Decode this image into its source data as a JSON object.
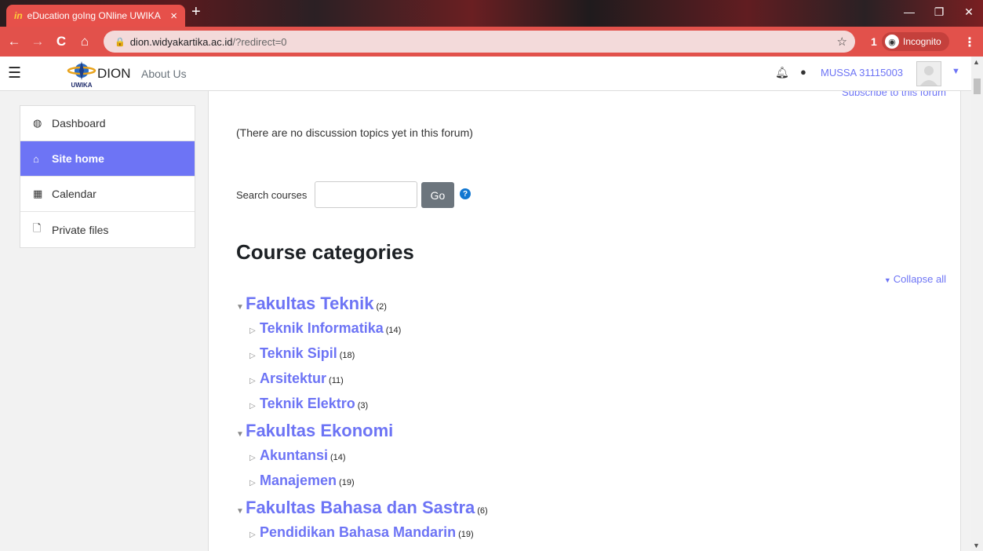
{
  "browser": {
    "tab_favicon": "in",
    "tab_title": "eDucation goIng ONline UWIKA",
    "tab_close": "×",
    "new_tab": "+",
    "url_host": "dion.widyakartika.ac.id",
    "url_path": "/?redirect=0",
    "incognito_label": "Incognito",
    "window_min": "—",
    "window_max": "❐",
    "window_close": "✕"
  },
  "navbar": {
    "brand": "DION",
    "logo_text": "UWIKA",
    "about": "About Us",
    "user_name": "MUSSA 31115003"
  },
  "sidebar": {
    "items": [
      {
        "label": "Dashboard",
        "icon": "dashboard-icon"
      },
      {
        "label": "Site home",
        "icon": "home-icon",
        "active": true
      },
      {
        "label": "Calendar",
        "icon": "calendar-icon"
      },
      {
        "label": "Private files",
        "icon": "file-icon"
      }
    ]
  },
  "main": {
    "subscribe": "Subscribe to this forum",
    "empty_message": "(There are no discussion topics yet in this forum)",
    "search_label": "Search courses",
    "search_value": "",
    "go_label": "Go",
    "heading": "Course categories",
    "collapse_label": "Collapse all",
    "categories": [
      {
        "name": "Fakultas Teknik",
        "count": "(2)",
        "sub": [
          {
            "name": "Teknik Informatika",
            "count": "(14)"
          },
          {
            "name": "Teknik Sipil",
            "count": "(18)"
          },
          {
            "name": "Arsitektur",
            "count": "(11)"
          },
          {
            "name": "Teknik Elektro",
            "count": "(3)"
          }
        ]
      },
      {
        "name": "Fakultas Ekonomi",
        "count": "",
        "sub": [
          {
            "name": "Akuntansi",
            "count": "(14)"
          },
          {
            "name": "Manajemen",
            "count": "(19)"
          }
        ]
      },
      {
        "name": "Fakultas Bahasa dan Sastra",
        "count": "(6)",
        "sub": [
          {
            "name": "Pendidikan Bahasa Mandarin",
            "count": "(19)"
          }
        ]
      }
    ]
  }
}
